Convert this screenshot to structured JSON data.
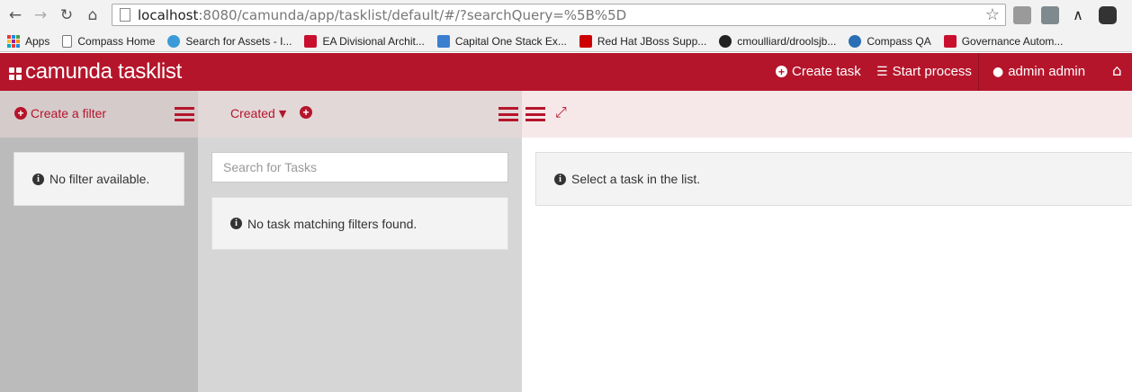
{
  "browser": {
    "url_host": "localhost",
    "url_rest": ":8080/camunda/app/tasklist/default/#/?searchQuery=%5B%5D",
    "bookmarks": [
      {
        "label": "Apps",
        "icon": "apps-grid-icon",
        "color": "#1a73e8"
      },
      {
        "label": "Compass Home",
        "icon": "page-icon",
        "color": "#ffffff"
      },
      {
        "label": "Search for Assets - I...",
        "icon": "globe-icon",
        "color": "#3b9bd8"
      },
      {
        "label": "EA Divisional Archit...",
        "icon": "capital-one-icon",
        "color": "#c8102e"
      },
      {
        "label": "Capital One Stack Ex...",
        "icon": "stack-exchange-icon",
        "color": "#3b7fd0"
      },
      {
        "label": "Red Hat JBoss Supp...",
        "icon": "redhat-icon",
        "color": "#cc0000"
      },
      {
        "label": "cmoulliard/droolsjb...",
        "icon": "github-icon",
        "color": "#222222"
      },
      {
        "label": "Compass QA",
        "icon": "compass-icon",
        "color": "#2a6fb5"
      },
      {
        "label": "Governance Autom...",
        "icon": "capital-one-icon",
        "color": "#c8102e"
      }
    ]
  },
  "header": {
    "brand": "camunda tasklist",
    "create_task": "Create task",
    "start_process": "Start process",
    "user": "admin admin"
  },
  "filters": {
    "create_filter": "Create a filter",
    "empty_message": "No filter available."
  },
  "list": {
    "sort_label": "Created",
    "search_placeholder": "Search for Tasks",
    "empty_message": "No task matching filters found."
  },
  "view": {
    "empty_message": "Select a task in the list."
  },
  "colors": {
    "brand": "#b5152b"
  }
}
